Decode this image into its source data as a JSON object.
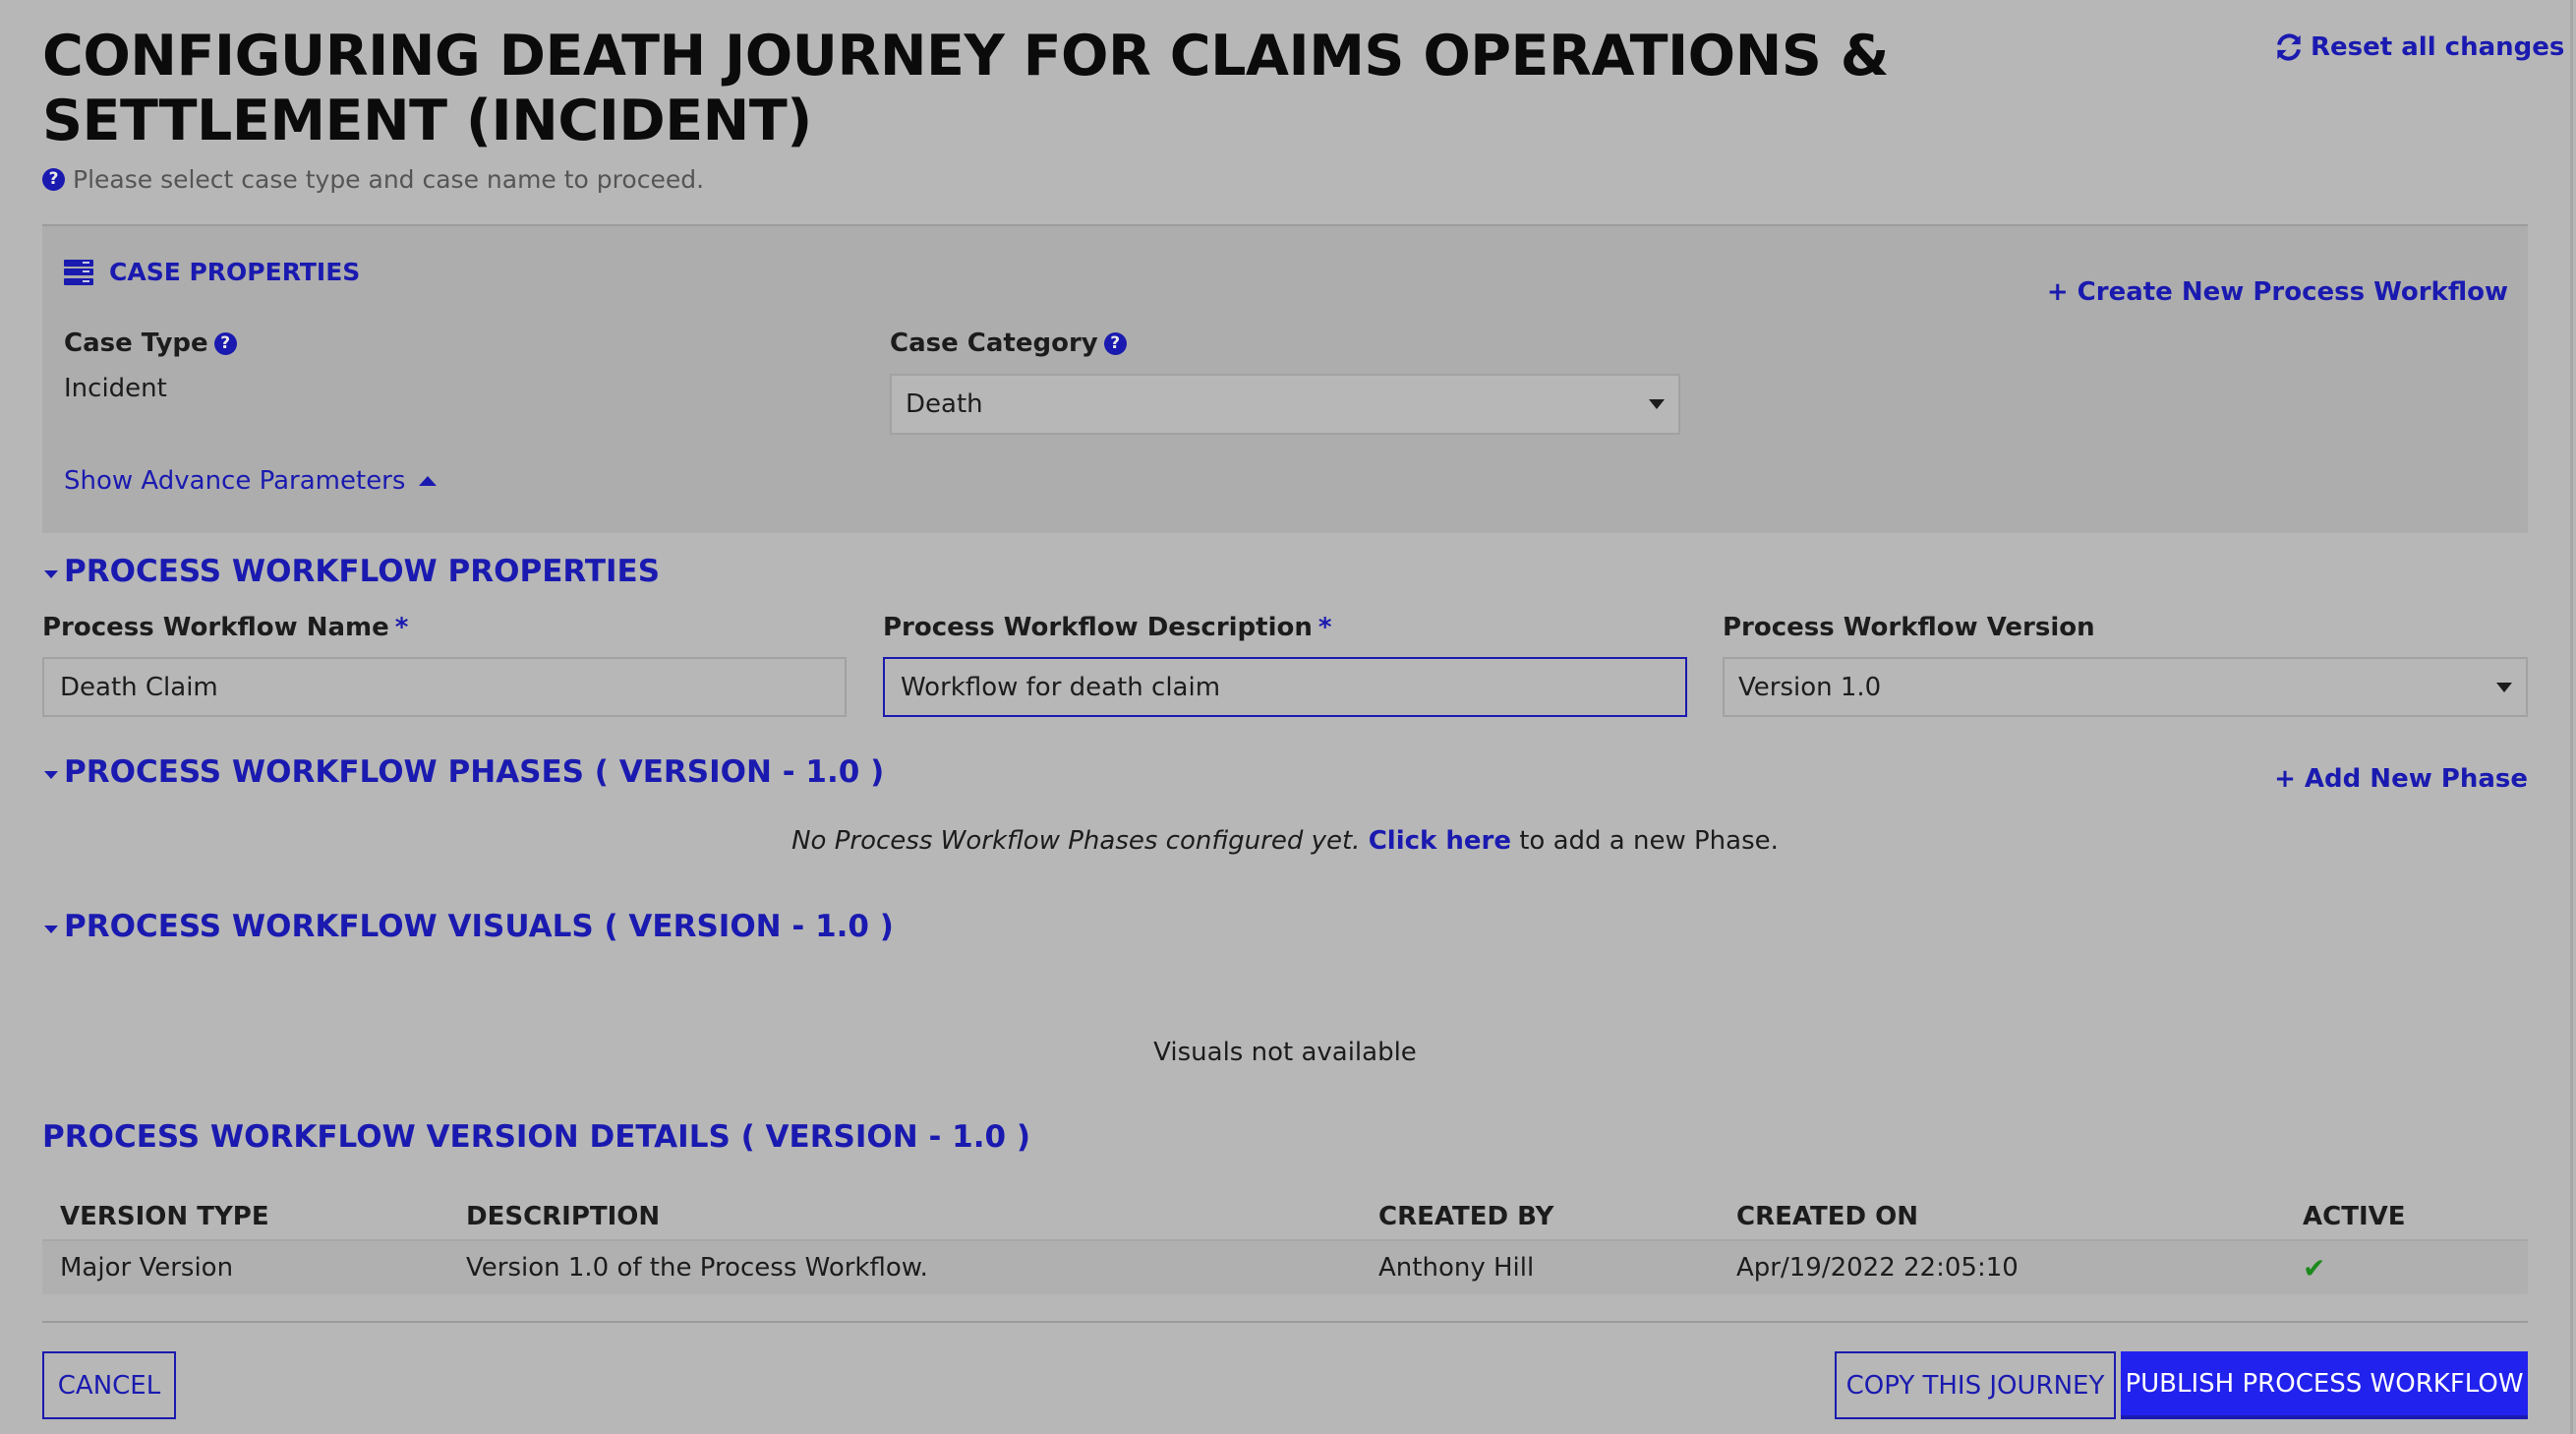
{
  "header": {
    "title": "CONFIGURING DEATH JOURNEY FOR CLAIMS OPERATIONS & SETTLEMENT (INCIDENT)",
    "reset_label": "Reset all changes",
    "hint": "Please select case type and case name to proceed."
  },
  "case_properties": {
    "title": "CASE PROPERTIES",
    "create_link": "+ Create New Process Workflow",
    "case_type_label": "Case Type",
    "case_type_value": "Incident",
    "case_category_label": "Case Category",
    "case_category_value": "Death",
    "advance_link": "Show Advance Parameters"
  },
  "workflow_properties": {
    "heading": "PROCESS WORKFLOW PROPERTIES",
    "name_label": "Process Workflow Name",
    "name_value": "Death Claim",
    "description_label": "Process Workflow Description",
    "description_value": "Workflow for death claim",
    "version_label": "Process Workflow Version",
    "version_value": "Version 1.0",
    "required_mark": "*"
  },
  "phases": {
    "heading": "PROCESS WORKFLOW PHASES ( VERSION - 1.0 )",
    "add_link": "+ Add New Phase",
    "empty_text": "No Process Workflow Phases configured yet.",
    "empty_link": "Click here",
    "empty_suffix": " to add a new Phase."
  },
  "visuals": {
    "heading": "PROCESS WORKFLOW VISUALS ( VERSION - 1.0 )",
    "empty_text": "Visuals not available"
  },
  "version_details": {
    "heading": "PROCESS WORKFLOW VERSION DETAILS ( VERSION - 1.0 )",
    "columns": [
      "VERSION TYPE",
      "DESCRIPTION",
      "CREATED BY",
      "CREATED ON",
      "ACTIVE"
    ],
    "rows": [
      {
        "version_type": "Major Version",
        "description": "Version 1.0 of the Process Workflow.",
        "created_by": "Anthony Hill",
        "created_on": "Apr/19/2022 22:05:10",
        "active": "✔"
      }
    ]
  },
  "footer": {
    "cancel_label": "CANCEL",
    "copy_label": "COPY THIS JOURNEY",
    "publish_label": "PUBLISH PROCESS WORKFLOW"
  },
  "icons": {
    "help": "?",
    "reset": "⟳"
  },
  "colors": {
    "accent": "#1a1ab0",
    "primary_button": "#2222ee",
    "background": "#b7b7b7",
    "panel": "#adadad",
    "active_check": "#1b8a1b"
  }
}
